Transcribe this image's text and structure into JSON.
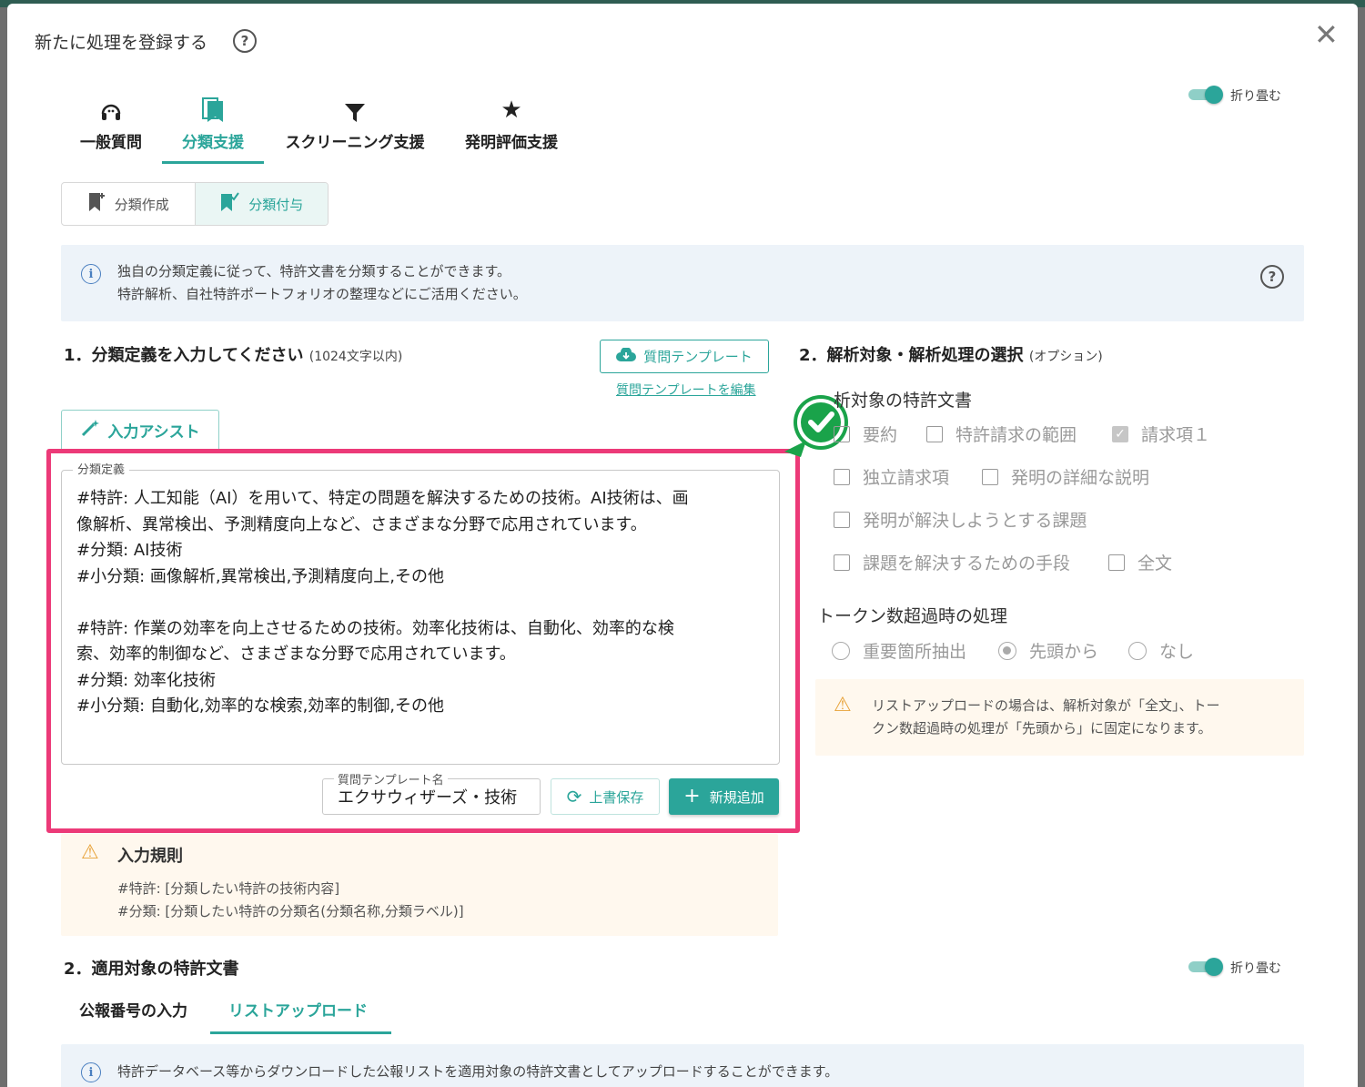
{
  "modal": {
    "title": "新たに処理を登録する",
    "collapse_label": "折り畳む"
  },
  "main_tabs": [
    {
      "label": "一般質問",
      "icon": "headset-icon"
    },
    {
      "label": "分類支援",
      "icon": "bookmark-icon",
      "active": true
    },
    {
      "label": "スクリーニング支援",
      "icon": "filter-icon"
    },
    {
      "label": "発明評価支援",
      "icon": "star-icon"
    }
  ],
  "sub_tabs": [
    {
      "label": "分類作成",
      "icon": "bookmark-add-icon"
    },
    {
      "label": "分類付与",
      "icon": "bookmark-check-icon",
      "active": true
    }
  ],
  "info": {
    "line1": "独自の分類定義に従って、特許文書を分類することができます。",
    "line2": "特許解析、自社特許ポートフォリオの整理などにご活用ください。"
  },
  "section1": {
    "title": "1．分類定義を入力してください",
    "note": "(1024文字以内)",
    "template_button": "質問テンプレート",
    "edit_template_link": "質問テンプレートを編集",
    "assist_button": "入力アシスト",
    "field_label": "分類定義",
    "definition": "#特許: 人工知能（AI）を用いて、特定の問題を解決するための技術。AI技術は、画\n像解析、異常検出、予測精度向上など、さまざまな分野で応用されています。\n#分類: AI技術\n#小分類: 画像解析,異常検出,予測精度向上,その他\n\n#特許: 作業の効率を向上させるための技術。効率化技術は、自動化、効率的な検\n索、効率的制御など、さまざまな分野で応用されています。\n#分類: 効率化技術\n#小分類: 自動化,効率的な検索,効率的制御,その他",
    "template_name_label": "質問テンプレート名",
    "template_name_value": "エクサウィザーズ・技術",
    "overwrite_button": "上書保存",
    "add_button": "新規追加"
  },
  "input_rules": {
    "title": "入力規則",
    "line1": "#特許: [分類したい特許の技術内容]",
    "line2": "#分類: [分類したい特許の分類名(分類名称,分類ラベル)]"
  },
  "section2_right": {
    "title": "2．解析対象・解析処理の選択",
    "note": "(オプション)",
    "target_label": "析対象の特許文書",
    "checkboxes": [
      {
        "label": "要約",
        "checked": false
      },
      {
        "label": "特許請求の範囲",
        "checked": false
      },
      {
        "label": "請求項１",
        "checked": true
      },
      {
        "label": "独立請求項",
        "checked": false
      },
      {
        "label": "発明の詳細な説明",
        "checked": false
      },
      {
        "label": "発明が解決しようとする課題",
        "checked": false
      },
      {
        "label": "課題を解決するための手段",
        "checked": false
      },
      {
        "label": "全文",
        "checked": false
      }
    ],
    "token_label": "トークン数超過時の処理",
    "radios": [
      {
        "label": "重要箇所抽出",
        "selected": false
      },
      {
        "label": "先頭から",
        "selected": true
      },
      {
        "label": "なし",
        "selected": false
      }
    ],
    "warning_line1": "リストアップロードの場合は、解析対象が「全文」、トー",
    "warning_line2": "クン数超過時の処理が「先頭から」に固定になります。"
  },
  "section2_bottom": {
    "title": "2．適用対象の特許文書",
    "tabs": [
      {
        "label": "公報番号の入力"
      },
      {
        "label": "リストアップロード",
        "active": true
      }
    ],
    "info": "特許データベース等からダウンロードした公報リストを適用対象の特許文書としてアップロードすることができます。"
  },
  "colors": {
    "accent": "#2ba59a",
    "highlight": "#ec3a78",
    "badge": "#1aa34a"
  }
}
